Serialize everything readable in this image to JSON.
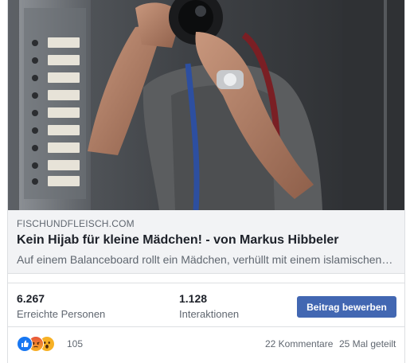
{
  "post": {
    "link": {
      "domain": "FISCHUNDFLEISCH.COM",
      "title": "Kein Hijab für kleine Mädchen! - von Markus Hibbeler",
      "description": "Auf einem Balanceboard rollt ein Mädchen, verhüllt mit einem islamischen…"
    },
    "stats": {
      "reach_value": "6.267",
      "reach_label": "Erreichte Personen",
      "engagement_value": "1.128",
      "engagement_label": "Interaktionen"
    },
    "promote_button": "Beitrag bewerben",
    "reactions": {
      "icons": [
        "like-icon",
        "angry-icon",
        "wow-icon"
      ],
      "count": "105"
    },
    "comments": "22 Kommentare",
    "shares": "25 Mal geteilt"
  },
  "colors": {
    "brand_button": "#4267b2",
    "secondary_text": "#606770",
    "link_box_bg": "#f2f3f5"
  }
}
